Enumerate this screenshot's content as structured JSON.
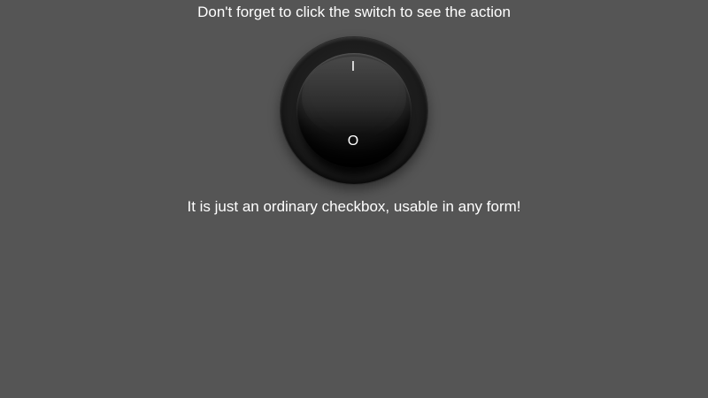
{
  "header": {
    "instruction": "Don't forget to click the switch to see the action"
  },
  "switch": {
    "on_mark": "I",
    "off_mark": "O",
    "checked": false
  },
  "footer": {
    "note": "It is just an ordinary checkbox, usable in any form!"
  },
  "colors": {
    "background": "#555555",
    "text": "#ffffff",
    "switch_body": "#1b1b1b"
  }
}
